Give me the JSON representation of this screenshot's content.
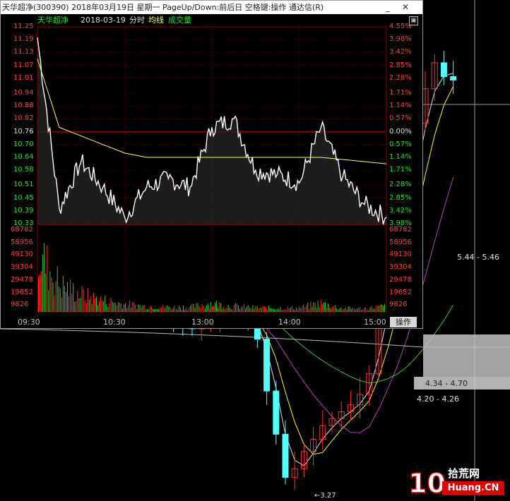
{
  "window": {
    "title": "天华超净(300390) 2018年03月19日 星期一 PageUp/Down:前后日 空格键:操作 通达信(R)",
    "minimize_glyph": "_",
    "close_glyph": "✕",
    "maximize_glyph": "□",
    "restore_glyph": "▣"
  },
  "subheader": {
    "stock_name": "天华超净",
    "date": "2018-03-19",
    "mode": "分时",
    "avg_label": "均线",
    "vol_label": "成交量"
  },
  "price_axis": {
    "labels": [
      "11.25",
      "11.19",
      "11.13",
      "11.07",
      "11.01",
      "10.94",
      "10.88",
      "10.82",
      "10.76",
      "10.70",
      "10.64",
      "10.58",
      "10.51",
      "10.45",
      "10.39",
      "10.33"
    ],
    "pct_labels": [
      "4.55%",
      "3.98%",
      "3.42%",
      "2.85%",
      "2.28%",
      "1.71%",
      "1.14%",
      "0.57%",
      "0.00%",
      "0.57%",
      "1.14%",
      "1.71%",
      "2.28%",
      "2.85%",
      "3.42%",
      "3.98%"
    ]
  },
  "volume_axis": {
    "labels": [
      "68782",
      "58956",
      "49130",
      "39304",
      "29478",
      "19652",
      "9826"
    ]
  },
  "time_axis": {
    "labels": [
      "09:30",
      "10:30",
      "13:00",
      "14:00",
      "15:00"
    ]
  },
  "operate_button": "操作",
  "kline_annotations": {
    "high_range": "5.44 - 5.46",
    "mid_range": "4.34 - 4.70",
    "low_range": "4.20 - 4.26",
    "bottom_low": "←3.27"
  },
  "watermark": {
    "text_top": "拾荒网",
    "text_bottom": "Huang.CN",
    "badge": "10"
  },
  "colors": {
    "up": "#ff3232",
    "down": "#54fcfc",
    "grid_red": "#8b0000",
    "avg_line": "#ffff66",
    "price_line": "#ffffff",
    "ma_magenta": "#c040c0",
    "ma_green": "#33cc33",
    "ma_yellow": "#ffff00",
    "ma_white": "#e0e0e0"
  },
  "chart_data": {
    "type": "line",
    "title": "天华超净 2018-03-19 分时",
    "x": [
      "09:30",
      "09:45",
      "10:00",
      "10:15",
      "10:30",
      "10:45",
      "11:00",
      "11:15",
      "13:00",
      "13:15",
      "13:30",
      "13:45",
      "14:00",
      "14:15",
      "14:30",
      "14:45",
      "15:00"
    ],
    "series": [
      {
        "name": "分时",
        "values": [
          11.2,
          10.4,
          10.62,
          10.5,
          10.36,
          10.5,
          10.54,
          10.5,
          10.78,
          10.82,
          10.58,
          10.56,
          10.52,
          10.78,
          10.55,
          10.42,
          10.36
        ]
      },
      {
        "name": "均线",
        "values": [
          11.1,
          10.78,
          10.74,
          10.7,
          10.66,
          10.64,
          10.64,
          10.64,
          10.64,
          10.64,
          10.64,
          10.64,
          10.64,
          10.64,
          10.63,
          10.62,
          10.61
        ]
      }
    ],
    "volume": [
      60000,
      28000,
      18000,
      12000,
      8000,
      6000,
      5000,
      5000,
      9000,
      6000,
      4500,
      4000,
      4000,
      9000,
      4000,
      3500,
      6000
    ],
    "ylim": [
      10.33,
      11.25
    ],
    "xlabel": "",
    "ylabel": ""
  }
}
